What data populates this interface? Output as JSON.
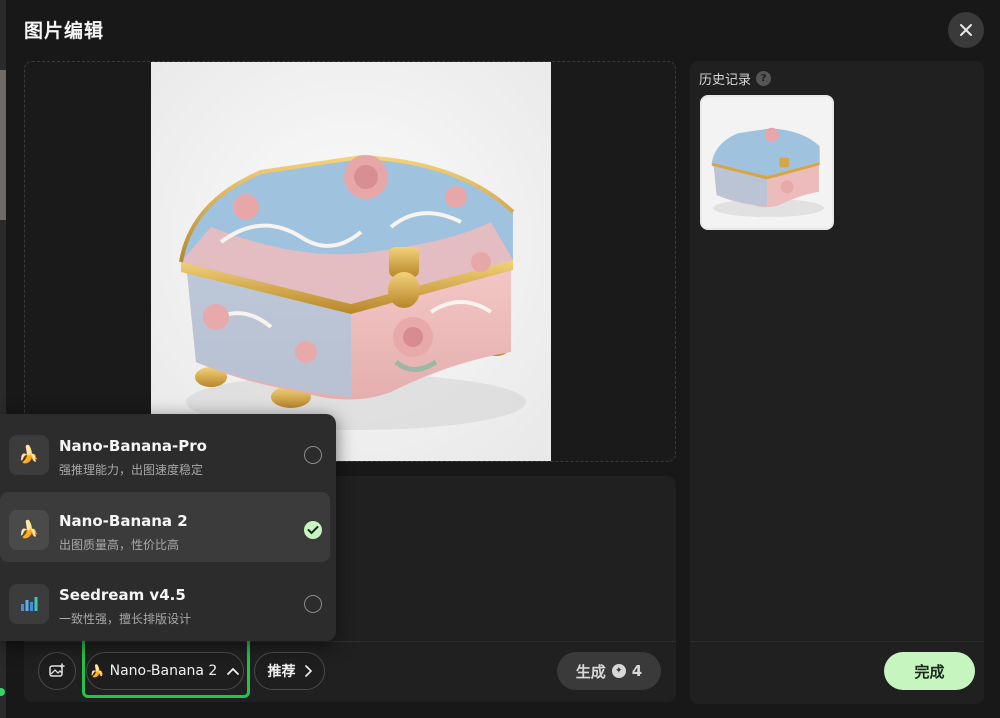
{
  "dialog": {
    "title": "图片编辑",
    "close_icon": "close-icon"
  },
  "canvas": {
    "image_subject": "ornate porcelain jewelry box"
  },
  "history": {
    "title": "历史记录",
    "help_glyph": "?"
  },
  "toolbar": {
    "upload_icon": "image-upload-icon",
    "model_emoji": "🍌",
    "model_label": "Nano-Banana 2",
    "recommend_label": "推荐",
    "generate_label": "生成",
    "generate_cost": "4",
    "done_label": "完成"
  },
  "model_options": [
    {
      "emoji": "🍌",
      "name": "Nano-Banana-Pro",
      "desc": "强推理能力，出图速度稳定",
      "selected": false
    },
    {
      "emoji": "🍌",
      "name": "Nano-Banana 2",
      "desc": "出图质量高，性价比高",
      "selected": true
    },
    {
      "icon": "bar-chart-icon",
      "name": "Seedream v4.5",
      "desc": "一致性强，擅长排版设计",
      "selected": false
    }
  ],
  "colors": {
    "accent_green": "#27c24c",
    "done_bg": "#c6f5c0",
    "panel_bg": "#202020"
  }
}
